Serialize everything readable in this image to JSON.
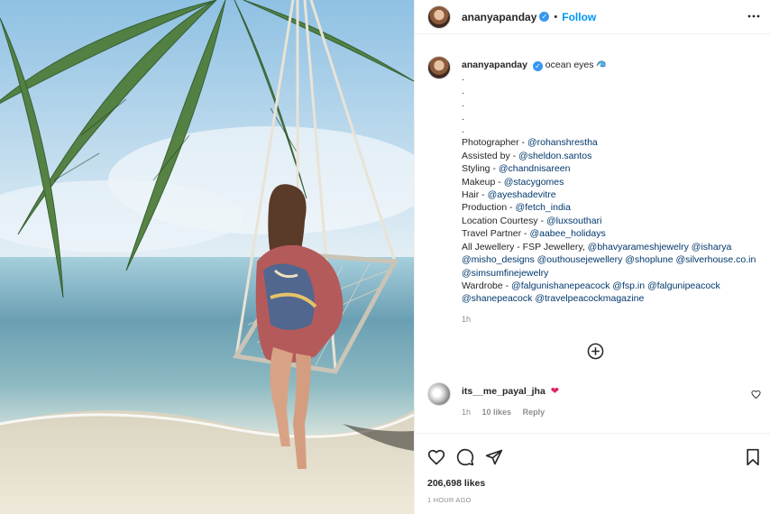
{
  "post": {
    "username": "ananyapanday",
    "verified_glyph": "✓",
    "separator": "•",
    "follow_label": "Follow",
    "caption": {
      "first_line": "ocean eyes",
      "dots": [
        ".",
        ".",
        ".",
        ".",
        "."
      ],
      "credits": [
        {
          "prefix": "Photographer - ",
          "mentions": [
            "@rohanshrestha"
          ]
        },
        {
          "prefix": "Assisted by - ",
          "mentions": [
            "@sheldon.santos"
          ]
        },
        {
          "prefix": "Styling - ",
          "mentions": [
            "@chandnisareen"
          ]
        },
        {
          "prefix": "Makeup - ",
          "mentions": [
            "@stacygomes"
          ]
        },
        {
          "prefix": "Hair - ",
          "mentions": [
            "@ayeshadevitre"
          ]
        },
        {
          "prefix": "Production - ",
          "mentions": [
            "@fetch_india"
          ]
        },
        {
          "prefix": "Location Courtesy - ",
          "mentions": [
            "@luxsouthari"
          ]
        },
        {
          "prefix": "Travel Partner - ",
          "mentions": [
            "@aabee_holidays"
          ]
        }
      ],
      "jewellery_prefix": "All Jewellery - FSP Jewellery, ",
      "jewellery_mentions": [
        "@bhavyarameshjewelry",
        "@isharya",
        "@misho_designs",
        "@outhousejewellery",
        "@shoplune",
        "@silverhouse.co.in",
        "@simsumfinejewelry"
      ],
      "wardrobe_prefix": "Wardrobe - ",
      "wardrobe_mentions": [
        "@falgunishanepeacock",
        "@fsp.in",
        "@falgunipeacock",
        "@shanepeacock",
        "@travelpeacockmagazine"
      ],
      "time": "1h"
    },
    "comment": {
      "username": "its__me_payal_jha",
      "emoji": "❤",
      "time": "1h",
      "likes": "10 likes",
      "reply_label": "Reply"
    },
    "likes_count": "206,698 likes",
    "posted_ago": "1 HOUR AGO"
  },
  "icons": {
    "more": "more-horizontal-icon",
    "load_more": "plus-circle-icon",
    "like": "heart-icon",
    "comment": "comment-icon",
    "share": "paper-plane-icon",
    "save": "bookmark-icon"
  },
  "colors": {
    "accent": "#0095f6",
    "verified": "#3897f0",
    "mention": "#00376b",
    "muted": "#8e8e8e",
    "heart_red": "#e0245e"
  }
}
